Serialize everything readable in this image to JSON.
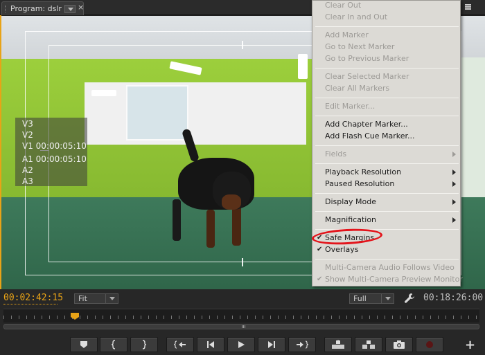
{
  "panel": {
    "tab_label": "Program: dslr",
    "close_glyph": "×",
    "menu_icon": "panel-menu-icon"
  },
  "overlay": {
    "tracks": [
      "V3",
      "V2",
      "V1 00:00:05:10",
      "A1 00:00:05:10",
      "A2",
      "A3"
    ]
  },
  "context_menu": {
    "items": [
      {
        "label": "Clear Out",
        "enabled": false
      },
      {
        "label": "Clear In and Out",
        "enabled": false
      },
      {
        "label": "Add Marker",
        "enabled": false
      },
      {
        "label": "Go to Next Marker",
        "enabled": false
      },
      {
        "label": "Go to Previous Marker",
        "enabled": false
      },
      {
        "label": "Clear Selected Marker",
        "enabled": false
      },
      {
        "label": "Clear All Markers",
        "enabled": false
      },
      {
        "label": "Edit Marker...",
        "enabled": false
      },
      {
        "label": "Add Chapter Marker...",
        "enabled": true
      },
      {
        "label": "Add Flash Cue Marker...",
        "enabled": true
      },
      {
        "label": "Fields",
        "enabled": false,
        "submenu": true
      },
      {
        "label": "Playback Resolution",
        "enabled": true,
        "submenu": true
      },
      {
        "label": "Paused Resolution",
        "enabled": true,
        "submenu": true
      },
      {
        "label": "Display Mode",
        "enabled": true,
        "submenu": true
      },
      {
        "label": "Magnification",
        "enabled": true,
        "submenu": true
      },
      {
        "label": "Safe Margins",
        "enabled": true,
        "checked": true
      },
      {
        "label": "Overlays",
        "enabled": true,
        "checked": true
      },
      {
        "label": "Multi-Camera Audio Follows Video",
        "enabled": false
      },
      {
        "label": "Show Multi-Camera Preview Monitor",
        "enabled": false,
        "checked": true
      }
    ],
    "check_glyph": "✔",
    "highlight_color": "#e3141b"
  },
  "controls": {
    "current_time": "00:02:42:15",
    "zoom_value": "Fit",
    "resolution_value": "Full",
    "duration": "00:18:26:00",
    "add_glyph": "+",
    "accent_color": "#e8a317"
  }
}
